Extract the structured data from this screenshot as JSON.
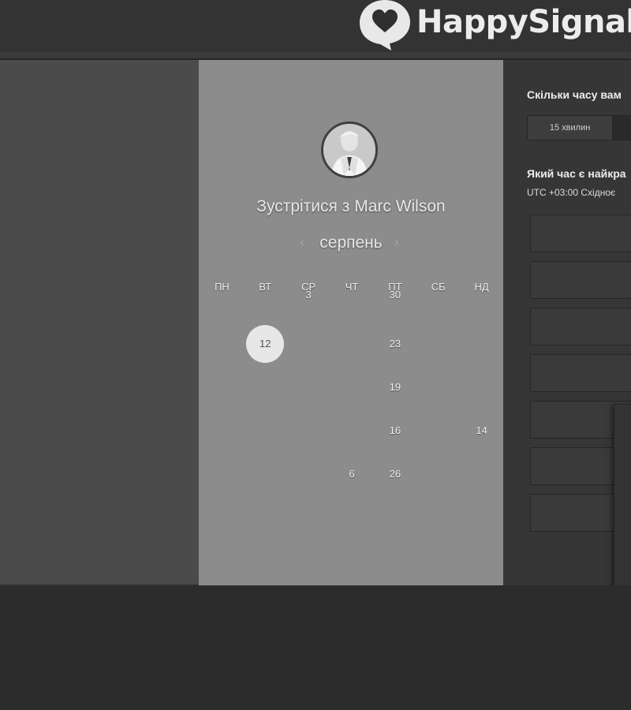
{
  "header": {
    "logo_text": "HappySignal",
    "colors": {
      "background": "#333333",
      "logo": "#ececec"
    }
  },
  "calendar": {
    "avatar": "avatar-photo",
    "title": "Зустрітися з Marc Wilson",
    "month": "серпень",
    "prev_icon": "‹",
    "next_icon": "›",
    "weekdays": [
      "ПН",
      "ВТ",
      "СР",
      "ЧТ",
      "ПТ",
      "СБ",
      "НД"
    ],
    "weeks": [
      [
        "",
        "",
        "3",
        "",
        "30",
        "",
        ""
      ],
      [
        "",
        "12",
        "",
        "",
        "23",
        "",
        ""
      ],
      [
        "",
        "",
        "",
        "",
        "19",
        "",
        ""
      ],
      [
        "",
        "",
        "",
        "",
        "16",
        "",
        "14"
      ],
      [
        "",
        "",
        "",
        "6",
        "26",
        "",
        ""
      ]
    ],
    "selected_day": "12",
    "colors": {
      "panel": "#8c8c8c",
      "selected": "#e7e7e7"
    }
  },
  "booking": {
    "duration_question": "Скільки часу вам",
    "duration_options": [
      "15 хвилин"
    ],
    "time_question": "Який час є найкра",
    "timezone": "UTC +03:00 Східноє"
  }
}
